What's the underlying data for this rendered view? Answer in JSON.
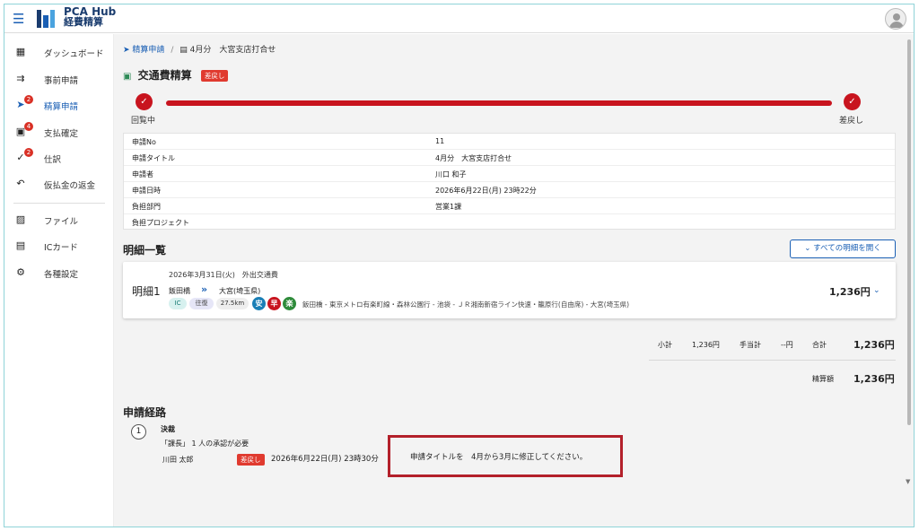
{
  "header": {
    "brand_line1": "PCA Hub",
    "brand_line2": "経費精算",
    "menu_icon": "hamburger-icon",
    "avatar_icon": "user-avatar-icon"
  },
  "sidebar": {
    "items": [
      {
        "label": "ダッシュボード",
        "icon": "dashboard-icon",
        "badge": ""
      },
      {
        "label": "事前申請",
        "icon": "pre-request-icon",
        "badge": ""
      },
      {
        "label": "精算申請",
        "icon": "send-icon",
        "badge": "2"
      },
      {
        "label": "支払確定",
        "icon": "payment-icon",
        "badge": "4"
      },
      {
        "label": "仕訳",
        "icon": "check-icon",
        "badge": "2"
      },
      {
        "label": "仮払金の返金",
        "icon": "undo-icon",
        "badge": ""
      },
      {
        "label": "ファイル",
        "icon": "image-file-icon",
        "badge": ""
      },
      {
        "label": "ICカード",
        "icon": "ic-card-icon",
        "badge": ""
      },
      {
        "label": "各種設定",
        "icon": "gear-icon",
        "badge": ""
      }
    ]
  },
  "breadcrumb": {
    "parent": "精算申請",
    "separator": "/",
    "current": "4月分　大宮支店打合せ"
  },
  "page": {
    "title": "交通費精算",
    "status_tag": "差戻し"
  },
  "progress": {
    "steps": [
      {
        "label": "回覧中"
      },
      {
        "label": "差戻し"
      }
    ],
    "complete_fraction": 1.0,
    "color": "#c8141e"
  },
  "info": {
    "rows": [
      {
        "key": "申請No",
        "value": "11"
      },
      {
        "key": "申請タイトル",
        "value": "4月分　大宮支店打合せ"
      },
      {
        "key": "申請者",
        "value": "川口 和子"
      },
      {
        "key": "申請日時",
        "value": "2026年6月22日(月) 23時22分"
      },
      {
        "key": "負担部門",
        "value": "営業1課"
      },
      {
        "key": "負担プロジェクト",
        "value": ""
      }
    ]
  },
  "details": {
    "heading": "明細一覧",
    "open_all_label": "すべての明細を開く",
    "items": [
      {
        "date": "2026年3月31日(火)　外出交通費",
        "name": "明細1",
        "from": "飯田橋",
        "to": "大宮(埼玉県)",
        "chips": [
          "IC",
          "往復",
          "27.5km"
        ],
        "marks": [
          "安",
          "早",
          "楽"
        ],
        "route": "飯田橋 - 東京メトロ有楽町線・森林公園行 - 池袋 - ＪＲ湘南新宿ライン快速・籠原行(自由席) - 大宮(埼玉県)",
        "amount": "1,236円"
      }
    ]
  },
  "totals": {
    "subtotal_label": "小計",
    "subtotal_value": "1,236円",
    "allowance_label": "手当計",
    "allowance_value": "--円",
    "total_label": "合計",
    "total_value": "1,236円",
    "settle_label": "精算額",
    "settle_value": "1,236円"
  },
  "route_section": {
    "heading": "申請経路",
    "step_number": "1",
    "step_title": "決裁",
    "requirement": "「課長」 1 人の承認が必要",
    "approver": "川田 太郎",
    "status": "差戻し",
    "datetime": "2026年6月22日(月) 23時30分",
    "comment": "申請タイトルを　4月から3月に修正してください。"
  },
  "colors": {
    "accent": "#1a5fb4",
    "danger": "#c8141e",
    "tag": "#e03a2f"
  }
}
